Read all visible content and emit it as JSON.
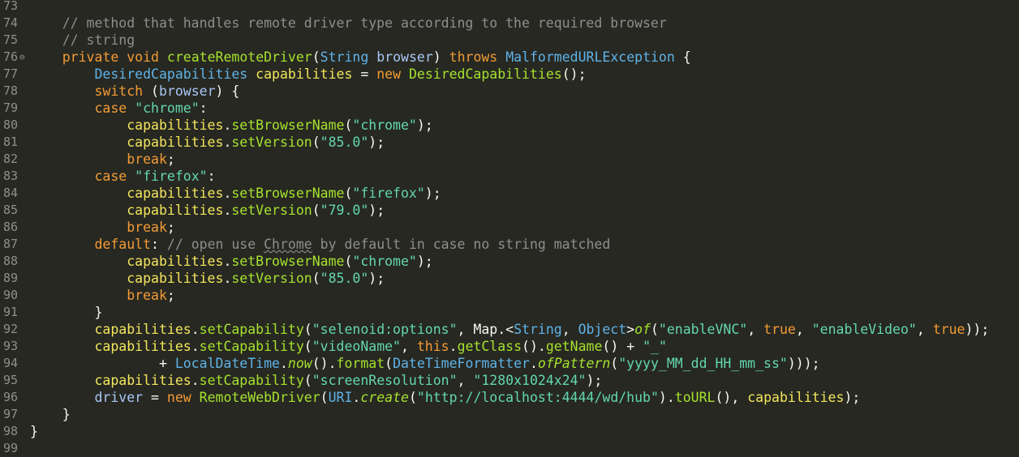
{
  "theme": {
    "background": "#272822",
    "gutter_text": "#8f908a"
  },
  "editor": {
    "first_line": 73,
    "folded_marker_line": 76,
    "lines": [
      {
        "num": "73",
        "tokens": []
      },
      {
        "num": "74",
        "tokens": [
          [
            "    // method that handles remote driver type according to the required browser",
            "cmt"
          ]
        ]
      },
      {
        "num": "75",
        "tokens": [
          [
            "    // string",
            "cmt"
          ]
        ]
      },
      {
        "num": "76",
        "fold": "⊖",
        "tokens": [
          [
            "    ",
            "plain"
          ],
          [
            "private",
            "kw"
          ],
          [
            " ",
            "plain"
          ],
          [
            "void",
            "kw"
          ],
          [
            " ",
            "plain"
          ],
          [
            "createRemoteDriver",
            "fn"
          ],
          [
            "(",
            "plain"
          ],
          [
            "String",
            "type"
          ],
          [
            " ",
            "plain"
          ],
          [
            "browser",
            "param"
          ],
          [
            ") ",
            "plain"
          ],
          [
            "throws",
            "kw"
          ],
          [
            " ",
            "plain"
          ],
          [
            "MalformedURLException",
            "type"
          ],
          [
            " {",
            "plain"
          ]
        ]
      },
      {
        "num": "77",
        "tokens": [
          [
            "        ",
            "plain"
          ],
          [
            "DesiredCapabilities",
            "type"
          ],
          [
            " ",
            "plain"
          ],
          [
            "capabilities",
            "var"
          ],
          [
            " = ",
            "plain"
          ],
          [
            "new",
            "kw"
          ],
          [
            " ",
            "plain"
          ],
          [
            "DesiredCapabilities",
            "fn"
          ],
          [
            "();",
            "plain"
          ]
        ]
      },
      {
        "num": "78",
        "tokens": [
          [
            "        ",
            "plain"
          ],
          [
            "switch",
            "kw"
          ],
          [
            " (",
            "plain"
          ],
          [
            "browser",
            "param"
          ],
          [
            ") {",
            "plain"
          ]
        ]
      },
      {
        "num": "79",
        "tokens": [
          [
            "        ",
            "plain"
          ],
          [
            "case",
            "kw"
          ],
          [
            " ",
            "plain"
          ],
          [
            "\"chrome\"",
            "str"
          ],
          [
            ":",
            "plain"
          ]
        ]
      },
      {
        "num": "80",
        "tokens": [
          [
            "            ",
            "plain"
          ],
          [
            "capabilities",
            "var"
          ],
          [
            ".",
            "plain"
          ],
          [
            "setBrowserName",
            "fn"
          ],
          [
            "(",
            "plain"
          ],
          [
            "\"chrome\"",
            "str"
          ],
          [
            ");",
            "plain"
          ]
        ]
      },
      {
        "num": "81",
        "tokens": [
          [
            "            ",
            "plain"
          ],
          [
            "capabilities",
            "var"
          ],
          [
            ".",
            "plain"
          ],
          [
            "setVersion",
            "fn"
          ],
          [
            "(",
            "plain"
          ],
          [
            "\"85.0\"",
            "str"
          ],
          [
            ");",
            "plain"
          ]
        ]
      },
      {
        "num": "82",
        "tokens": [
          [
            "            ",
            "plain"
          ],
          [
            "break",
            "kw"
          ],
          [
            ";",
            "plain"
          ]
        ]
      },
      {
        "num": "83",
        "tokens": [
          [
            "        ",
            "plain"
          ],
          [
            "case",
            "kw"
          ],
          [
            " ",
            "plain"
          ],
          [
            "\"firefox\"",
            "str"
          ],
          [
            ":",
            "plain"
          ]
        ]
      },
      {
        "num": "84",
        "tokens": [
          [
            "            ",
            "plain"
          ],
          [
            "capabilities",
            "var"
          ],
          [
            ".",
            "plain"
          ],
          [
            "setBrowserName",
            "fn"
          ],
          [
            "(",
            "plain"
          ],
          [
            "\"firefox\"",
            "str"
          ],
          [
            ");",
            "plain"
          ]
        ]
      },
      {
        "num": "85",
        "tokens": [
          [
            "            ",
            "plain"
          ],
          [
            "capabilities",
            "var"
          ],
          [
            ".",
            "plain"
          ],
          [
            "setVersion",
            "fn"
          ],
          [
            "(",
            "plain"
          ],
          [
            "\"79.0\"",
            "str"
          ],
          [
            ");",
            "plain"
          ]
        ]
      },
      {
        "num": "86",
        "tokens": [
          [
            "            ",
            "plain"
          ],
          [
            "break",
            "kw"
          ],
          [
            ";",
            "plain"
          ]
        ]
      },
      {
        "num": "87",
        "tokens": [
          [
            "        ",
            "plain"
          ],
          [
            "default",
            "kw"
          ],
          [
            ": ",
            "plain"
          ],
          [
            "// open use ",
            "cmt"
          ],
          [
            "Chrome",
            "squig"
          ],
          [
            " by default in case no string matched",
            "cmt"
          ]
        ]
      },
      {
        "num": "88",
        "tokens": [
          [
            "            ",
            "plain"
          ],
          [
            "capabilities",
            "var"
          ],
          [
            ".",
            "plain"
          ],
          [
            "setBrowserName",
            "fn"
          ],
          [
            "(",
            "plain"
          ],
          [
            "\"chrome\"",
            "str"
          ],
          [
            ");",
            "plain"
          ]
        ]
      },
      {
        "num": "89",
        "tokens": [
          [
            "            ",
            "plain"
          ],
          [
            "capabilities",
            "var"
          ],
          [
            ".",
            "plain"
          ],
          [
            "setVersion",
            "fn"
          ],
          [
            "(",
            "plain"
          ],
          [
            "\"85.0\"",
            "str"
          ],
          [
            ");",
            "plain"
          ]
        ]
      },
      {
        "num": "90",
        "tokens": [
          [
            "            ",
            "plain"
          ],
          [
            "break",
            "kw"
          ],
          [
            ";",
            "plain"
          ]
        ]
      },
      {
        "num": "91",
        "tokens": [
          [
            "        }",
            "plain"
          ]
        ]
      },
      {
        "num": "92",
        "tokens": [
          [
            "        ",
            "plain"
          ],
          [
            "capabilities",
            "var"
          ],
          [
            ".",
            "plain"
          ],
          [
            "setCapability",
            "fn"
          ],
          [
            "(",
            "plain"
          ],
          [
            "\"selenoid:options\"",
            "str"
          ],
          [
            ", Map.<",
            "plain"
          ],
          [
            "String",
            "type"
          ],
          [
            ", ",
            "plain"
          ],
          [
            "Object",
            "type"
          ],
          [
            ">",
            "plain"
          ],
          [
            "of",
            "ital"
          ],
          [
            "(",
            "plain"
          ],
          [
            "\"enableVNC\"",
            "str"
          ],
          [
            ", ",
            "plain"
          ],
          [
            "true",
            "kw"
          ],
          [
            ", ",
            "plain"
          ],
          [
            "\"enableVideo\"",
            "str"
          ],
          [
            ", ",
            "plain"
          ],
          [
            "true",
            "kw"
          ],
          [
            "));",
            "plain"
          ]
        ]
      },
      {
        "num": "93",
        "tokens": [
          [
            "        ",
            "plain"
          ],
          [
            "capabilities",
            "var"
          ],
          [
            ".",
            "plain"
          ],
          [
            "setCapability",
            "fn"
          ],
          [
            "(",
            "plain"
          ],
          [
            "\"videoName\"",
            "str"
          ],
          [
            ", ",
            "plain"
          ],
          [
            "this",
            "kw"
          ],
          [
            ".",
            "plain"
          ],
          [
            "getClass",
            "fn"
          ],
          [
            "().",
            "plain"
          ],
          [
            "getName",
            "fn"
          ],
          [
            "() + ",
            "plain"
          ],
          [
            "\"_\"",
            "str"
          ]
        ]
      },
      {
        "num": "94",
        "tokens": [
          [
            "                + ",
            "plain"
          ],
          [
            "LocalDateTime",
            "type"
          ],
          [
            ".",
            "plain"
          ],
          [
            "now",
            "ital"
          ],
          [
            "().",
            "plain"
          ],
          [
            "format",
            "fn"
          ],
          [
            "(",
            "plain"
          ],
          [
            "DateTimeFormatter",
            "type"
          ],
          [
            ".",
            "plain"
          ],
          [
            "ofPattern",
            "ital"
          ],
          [
            "(",
            "plain"
          ],
          [
            "\"yyyy_MM_dd_HH_mm_ss\"",
            "str"
          ],
          [
            ")));",
            "plain"
          ]
        ]
      },
      {
        "num": "95",
        "tokens": [
          [
            "        ",
            "plain"
          ],
          [
            "capabilities",
            "var"
          ],
          [
            ".",
            "plain"
          ],
          [
            "setCapability",
            "fn"
          ],
          [
            "(",
            "plain"
          ],
          [
            "\"screenResolution\"",
            "str"
          ],
          [
            ", ",
            "plain"
          ],
          [
            "\"1280x1024x24\"",
            "str"
          ],
          [
            ");",
            "plain"
          ]
        ]
      },
      {
        "num": "96",
        "tokens": [
          [
            "        ",
            "plain"
          ],
          [
            "driver",
            "param"
          ],
          [
            " = ",
            "plain"
          ],
          [
            "new",
            "kw"
          ],
          [
            " ",
            "plain"
          ],
          [
            "RemoteWebDriver",
            "fn"
          ],
          [
            "(",
            "plain"
          ],
          [
            "URI",
            "type"
          ],
          [
            ".",
            "plain"
          ],
          [
            "create",
            "ital"
          ],
          [
            "(",
            "plain"
          ],
          [
            "\"http://localhost:4444/wd/hub\"",
            "str"
          ],
          [
            ").",
            "plain"
          ],
          [
            "toURL",
            "fn"
          ],
          [
            "(), ",
            "plain"
          ],
          [
            "capabilities",
            "var"
          ],
          [
            ");",
            "plain"
          ]
        ]
      },
      {
        "num": "97",
        "tokens": [
          [
            "    }",
            "plain"
          ]
        ]
      },
      {
        "num": "98",
        "tokens": [
          [
            "}",
            "plain"
          ]
        ]
      },
      {
        "num": "99",
        "tokens": []
      }
    ]
  }
}
